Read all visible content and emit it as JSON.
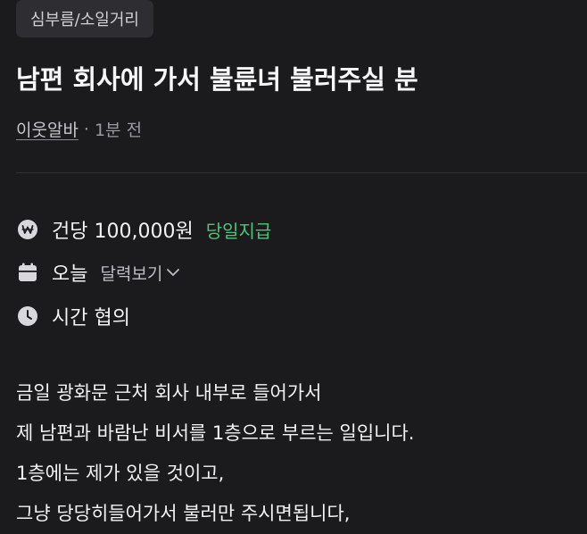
{
  "post": {
    "category": "심부름/소일거리",
    "title": "남편 회사에 가서 불륜녀 불러주실 분",
    "author": "이웃알바",
    "separator": "·",
    "time_ago": "1분 전"
  },
  "details": {
    "pay_text": "건당 100,000원",
    "pay_badge": "당일지급",
    "date_text": "오늘",
    "calendar_link": "달력보기",
    "time_text": "시간 협의"
  },
  "body": {
    "lines": [
      "금일 광화문 근처 회사 내부로 들어가서",
      "제 남편과 바람난 비서를 1층으로 부르는 일입니다.",
      "1층에는 제가 있을 것이고,",
      "그냥 당당히들어가서 불러만 주시면됩니다,"
    ]
  },
  "colors": {
    "background": "#1b1b1d",
    "tag_background": "#2e2e32",
    "accent_green": "#4fc378"
  },
  "icons": {
    "pay": "won-coin-icon",
    "date": "calendar-icon",
    "time": "clock-icon",
    "dropdown": "chevron-down-icon"
  }
}
